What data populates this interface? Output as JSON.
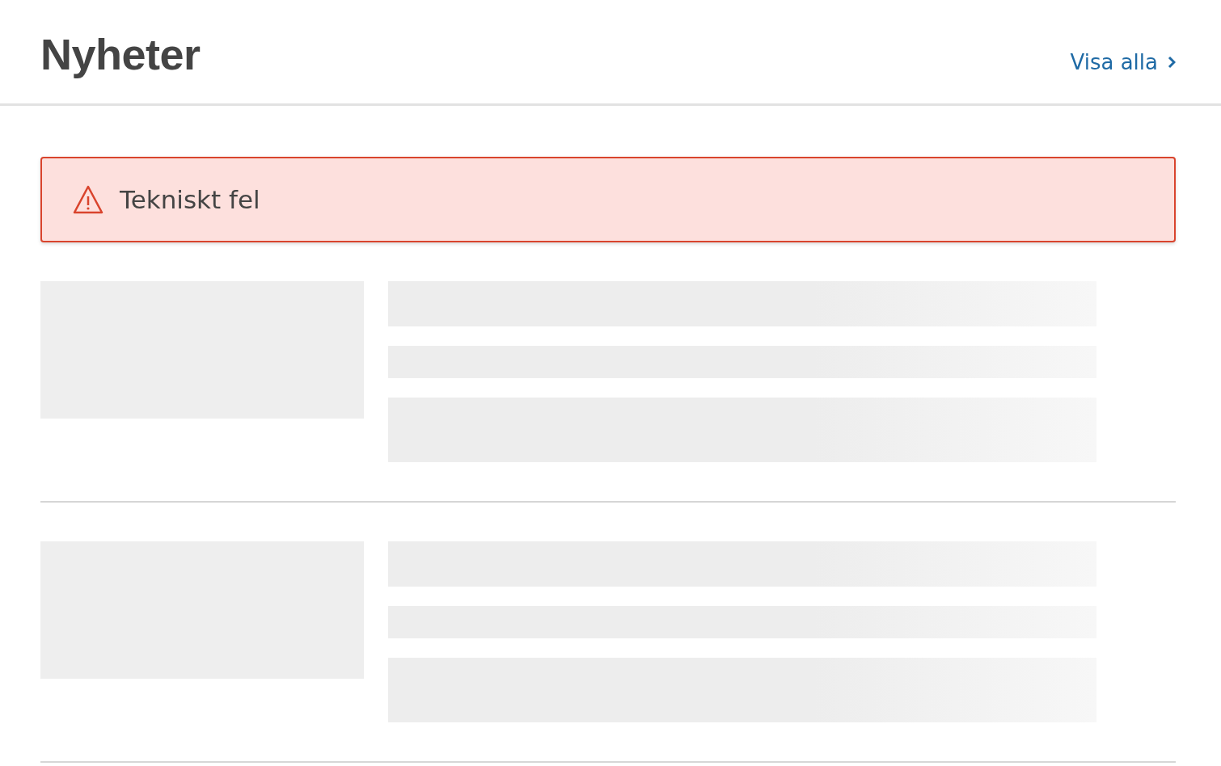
{
  "header": {
    "title": "Nyheter",
    "link": "Visa alla"
  },
  "alert": {
    "kind": "error",
    "message": "Tekniskt fel"
  },
  "news_items": [
    {
      "kind": "skeleton"
    },
    {
      "kind": "skeleton"
    }
  ]
}
